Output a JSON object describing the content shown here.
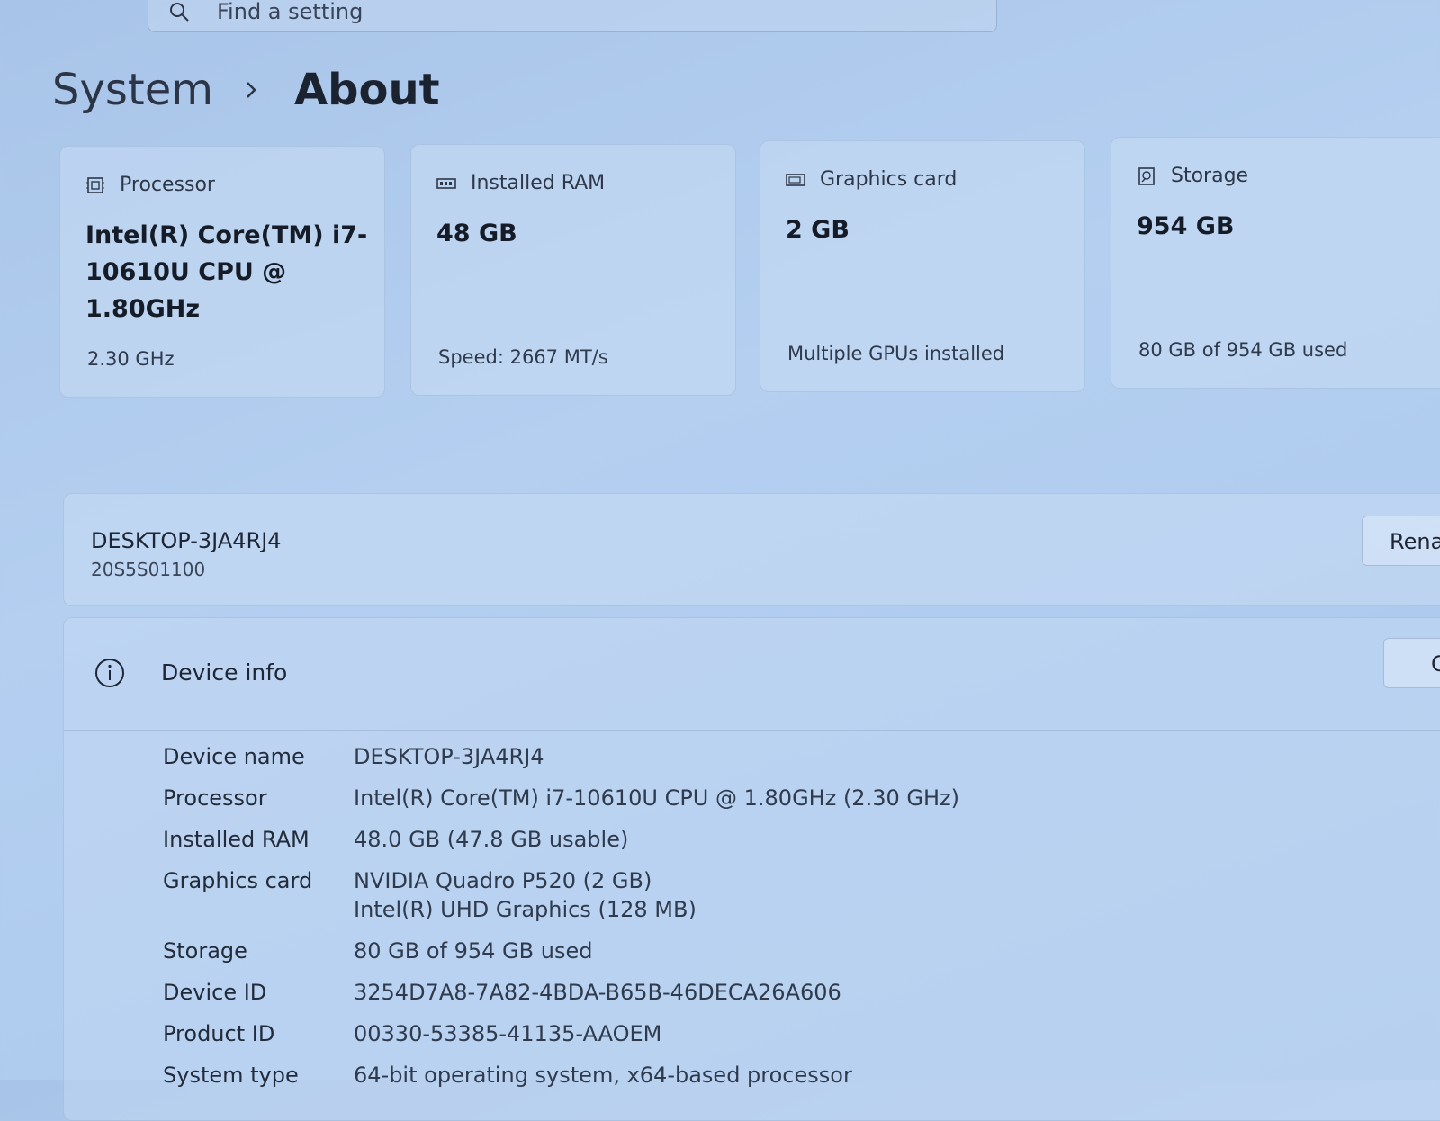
{
  "search": {
    "placeholder": "Find a setting"
  },
  "breadcrumb": {
    "parent": "System",
    "current": "About"
  },
  "cards": [
    {
      "title": "Processor",
      "value": "Intel(R) Core(TM) i7-10610U CPU @ 1.80GHz",
      "sub": "2.30 GHz",
      "icon": "processor-icon"
    },
    {
      "title": "Installed RAM",
      "value": "48 GB",
      "sub": "Speed: 2667 MT/s",
      "icon": "ram-icon"
    },
    {
      "title": "Graphics card",
      "value": "2 GB",
      "sub": "Multiple GPUs installed",
      "icon": "graphics-card-icon"
    },
    {
      "title": "Storage",
      "value": "954 GB",
      "sub": "80 GB of 954 GB used",
      "icon": "storage-icon"
    }
  ],
  "device": {
    "name": "DESKTOP-3JA4RJ4",
    "model": "20S5S01100",
    "rename_label": "Rename"
  },
  "device_info": {
    "title": "Device info",
    "copy_label": "Copy",
    "rows": [
      {
        "label": "Device name",
        "value": "DESKTOP-3JA4RJ4"
      },
      {
        "label": "Processor",
        "value": "Intel(R) Core(TM) i7-10610U CPU @ 1.80GHz (2.30 GHz)"
      },
      {
        "label": "Installed RAM",
        "value": "48.0 GB (47.8 GB usable)"
      },
      {
        "label": "Graphics card",
        "value": "NVIDIA Quadro P520 (2 GB)",
        "value2": "Intel(R) UHD Graphics (128 MB)"
      },
      {
        "label": "Storage",
        "value": "80 GB of 954 GB used"
      },
      {
        "label": "Device ID",
        "value": "3254D7A8-7A82-4BDA-B65B-46DECA26A606"
      },
      {
        "label": "Product ID",
        "value": "00330-53385-41135-AAOEM"
      },
      {
        "label": "System type",
        "value": "64-bit operating system, x64-based processor"
      }
    ]
  }
}
